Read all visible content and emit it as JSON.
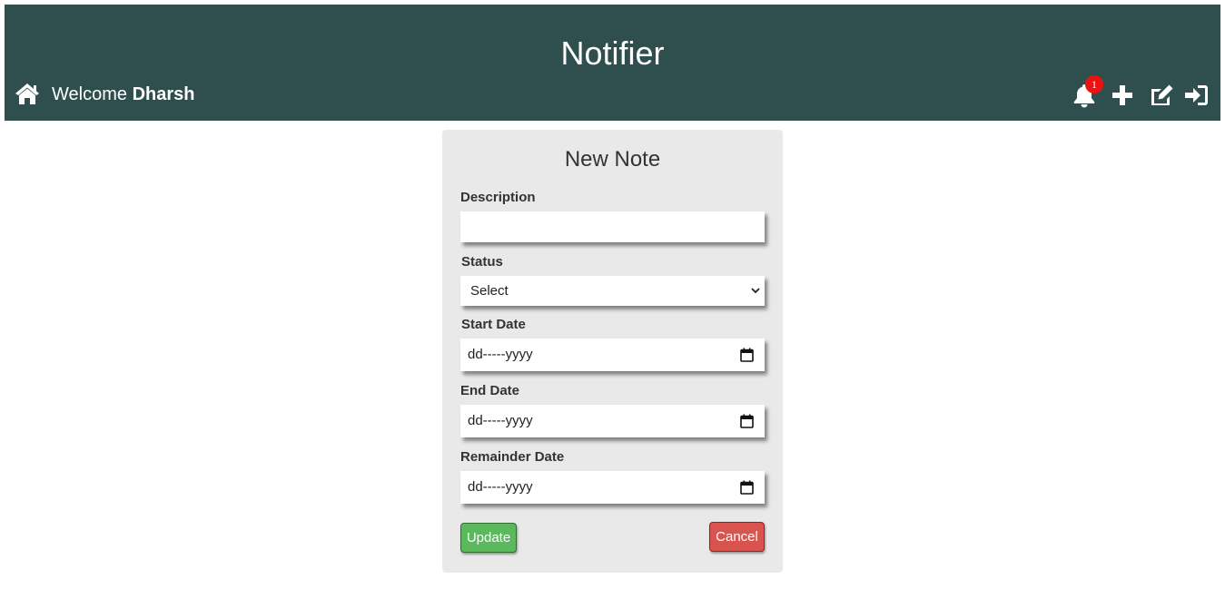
{
  "header": {
    "title": "Notifier",
    "welcome_prefix": "Welcome",
    "username": "Dharsh",
    "notification_count": "1",
    "icons": [
      "home-icon",
      "bell-icon",
      "plus-icon",
      "edit-icon",
      "sign-in-icon"
    ],
    "background_color": "#2f4f4f",
    "badge_color": "#ee1111"
  },
  "form": {
    "title": "New Note",
    "fields": {
      "description": {
        "label": "Description",
        "value": ""
      },
      "status": {
        "label": "Status",
        "selected": "Select"
      },
      "start_date": {
        "label": "Start Date",
        "placeholder": "dd-----yyyy"
      },
      "end_date": {
        "label": "End Date",
        "placeholder": "dd-----yyyy"
      },
      "remainder_date": {
        "label": "Remainder Date",
        "placeholder": "dd-----yyyy"
      }
    },
    "buttons": {
      "update": "Update",
      "cancel": "Cancel"
    },
    "colors": {
      "card_background": "#e9e9e9",
      "update_button": "#5cb85c",
      "cancel_button": "#d9534f"
    }
  }
}
